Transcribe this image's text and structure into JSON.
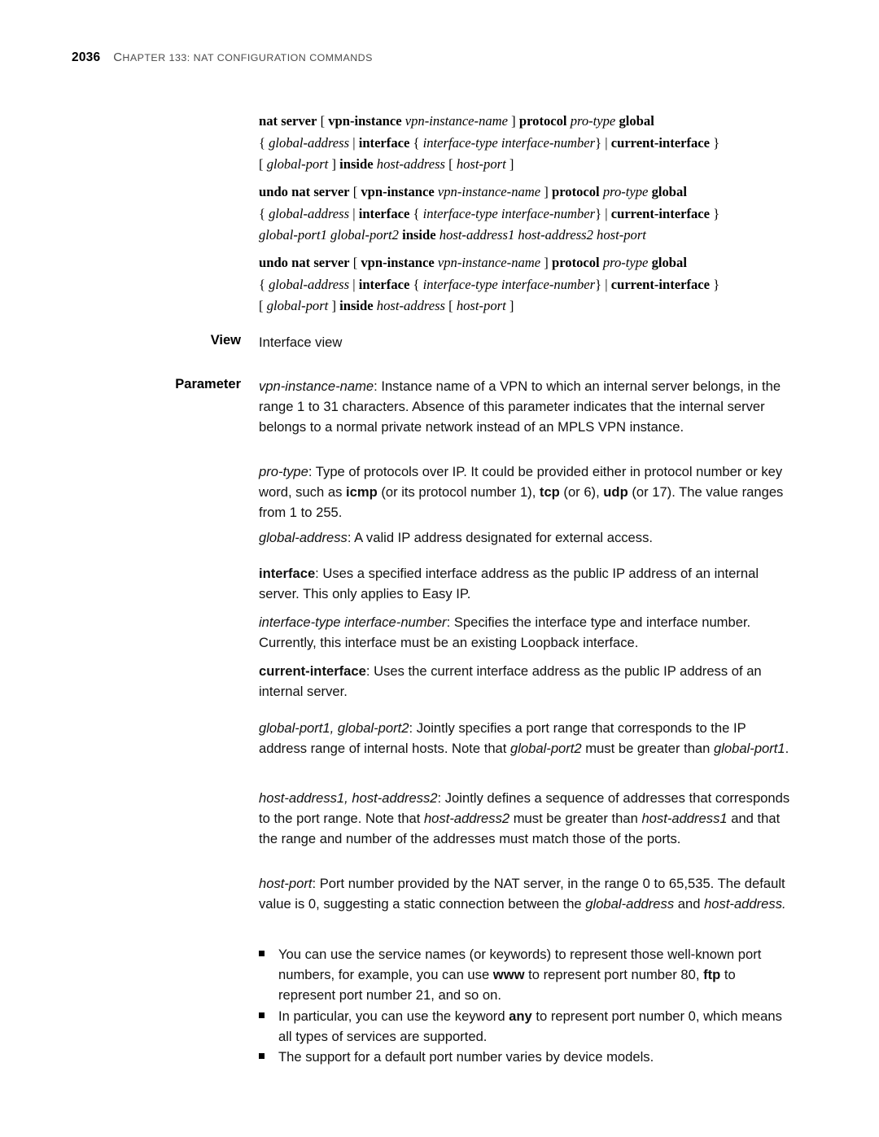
{
  "page": {
    "folio": "2036",
    "chapter_title_parts": {
      "c": "C",
      "hapter": "HAPTER",
      "num": " 133: NAT C",
      "onfiguration": "ONFIGURATION",
      "sep": " C",
      "ommands": "OMMANDS"
    },
    "chapter_title_plain": "CHAPTER 133: NAT CONFIGURATION COMMANDS"
  },
  "syntax_blocks": [
    {
      "id": "nat-server",
      "lines": [
        [
          {
            "t": "nat server",
            "s": "b"
          },
          {
            "t": " [ ",
            "s": "n"
          },
          {
            "t": "vpn-instance",
            "s": "b"
          },
          {
            "t": " ",
            "s": "n"
          },
          {
            "t": "vpn-instance-name",
            "s": "i"
          },
          {
            "t": " ] ",
            "s": "n"
          },
          {
            "t": "protocol",
            "s": "b"
          },
          {
            "t": " ",
            "s": "n"
          },
          {
            "t": "pro-type",
            "s": "i"
          },
          {
            "t": " ",
            "s": "n"
          },
          {
            "t": "global",
            "s": "b"
          }
        ],
        [
          {
            "t": "{ ",
            "s": "n"
          },
          {
            "t": "global-address",
            "s": "i"
          },
          {
            "t": " | ",
            "s": "n"
          },
          {
            "t": "interface",
            "s": "b"
          },
          {
            "t": " { ",
            "s": "n"
          },
          {
            "t": "interface-type interface-number",
            "s": "i"
          },
          {
            "t": "} | ",
            "s": "n"
          },
          {
            "t": "current-interface",
            "s": "b"
          },
          {
            "t": " }",
            "s": "n"
          }
        ],
        [
          {
            "t": "[ ",
            "s": "n"
          },
          {
            "t": "global-port",
            "s": "i"
          },
          {
            "t": " ] ",
            "s": "n"
          },
          {
            "t": "inside",
            "s": "b"
          },
          {
            "t": " ",
            "s": "n"
          },
          {
            "t": "host-address",
            "s": "i"
          },
          {
            "t": " [ ",
            "s": "n"
          },
          {
            "t": "host-port",
            "s": "i"
          },
          {
            "t": " ]",
            "s": "n"
          }
        ]
      ]
    },
    {
      "id": "undo-nat-server-range",
      "lines": [
        [
          {
            "t": "undo nat server",
            "s": "b"
          },
          {
            "t": " [ ",
            "s": "n"
          },
          {
            "t": "vpn-instance",
            "s": "b"
          },
          {
            "t": " ",
            "s": "n"
          },
          {
            "t": "vpn-instance-name",
            "s": "i"
          },
          {
            "t": " ] ",
            "s": "n"
          },
          {
            "t": "protocol",
            "s": "b"
          },
          {
            "t": " ",
            "s": "n"
          },
          {
            "t": "pro-type",
            "s": "i"
          },
          {
            "t": " ",
            "s": "n"
          },
          {
            "t": "global",
            "s": "b"
          }
        ],
        [
          {
            "t": "{ ",
            "s": "n"
          },
          {
            "t": "global-address",
            "s": "i"
          },
          {
            "t": " | ",
            "s": "n"
          },
          {
            "t": "interface",
            "s": "b"
          },
          {
            "t": " { ",
            "s": "n"
          },
          {
            "t": "interface-type interface-number",
            "s": "i"
          },
          {
            "t": "} | ",
            "s": "n"
          },
          {
            "t": "current-interface",
            "s": "b"
          },
          {
            "t": " }",
            "s": "n"
          }
        ],
        [
          {
            "t": "global-port1 global-port2",
            "s": "i"
          },
          {
            "t": " ",
            "s": "n"
          },
          {
            "t": "inside",
            "s": "b"
          },
          {
            "t": " ",
            "s": "n"
          },
          {
            "t": "host-address1 host-address2 host-port",
            "s": "i"
          }
        ]
      ]
    },
    {
      "id": "undo-nat-server-single",
      "lines": [
        [
          {
            "t": "undo nat server",
            "s": "b"
          },
          {
            "t": " [ ",
            "s": "n"
          },
          {
            "t": "vpn-instance",
            "s": "b"
          },
          {
            "t": " ",
            "s": "n"
          },
          {
            "t": "vpn-instance-name",
            "s": "i"
          },
          {
            "t": " ] ",
            "s": "n"
          },
          {
            "t": "protocol",
            "s": "b"
          },
          {
            "t": " ",
            "s": "n"
          },
          {
            "t": "pro-type",
            "s": "i"
          },
          {
            "t": " ",
            "s": "n"
          },
          {
            "t": "global",
            "s": "b"
          }
        ],
        [
          {
            "t": "{ ",
            "s": "n"
          },
          {
            "t": "global-address",
            "s": "i"
          },
          {
            "t": " | ",
            "s": "n"
          },
          {
            "t": "interface",
            "s": "b"
          },
          {
            "t": " { ",
            "s": "n"
          },
          {
            "t": "interface-type interface-number",
            "s": "i"
          },
          {
            "t": "} | ",
            "s": "n"
          },
          {
            "t": "current-interface",
            "s": "b"
          },
          {
            "t": " }",
            "s": "n"
          }
        ],
        [
          {
            "t": "[ ",
            "s": "n"
          },
          {
            "t": "global-port",
            "s": "i"
          },
          {
            "t": " ] ",
            "s": "n"
          },
          {
            "t": "inside",
            "s": "b"
          },
          {
            "t": " ",
            "s": "n"
          },
          {
            "t": "host-address",
            "s": "i"
          },
          {
            "t": " [ ",
            "s": "n"
          },
          {
            "t": "host-port",
            "s": "i"
          },
          {
            "t": " ]",
            "s": "n"
          }
        ]
      ]
    }
  ],
  "view": {
    "label": "View",
    "value": "Interface view"
  },
  "parameter": {
    "label": "Parameter",
    "paragraphs": [
      [
        {
          "t": "vpn-instance-name",
          "s": "i"
        },
        {
          "t": ": Instance name of a VPN to which an internal server belongs, in the range 1 to 31 characters. Absence of this parameter indicates that the internal server belongs to a normal private network instead of an MPLS VPN instance.",
          "s": "n"
        }
      ],
      [
        {
          "t": "pro-type",
          "s": "i"
        },
        {
          "t": ": Type of protocols over IP. It could be provided either in protocol number or key word, such as ",
          "s": "n"
        },
        {
          "t": "icmp",
          "s": "b"
        },
        {
          "t": " (or its protocol number 1), ",
          "s": "n"
        },
        {
          "t": "tcp",
          "s": "b"
        },
        {
          "t": " (or 6), ",
          "s": "n"
        },
        {
          "t": "udp",
          "s": "b"
        },
        {
          "t": " (or 17). The value ranges from 1 to 255.",
          "s": "n"
        }
      ],
      [
        {
          "t": "global-address",
          "s": "i"
        },
        {
          "t": ": A valid IP address designated for external access.",
          "s": "n"
        }
      ],
      [
        {
          "t": "interface",
          "s": "b"
        },
        {
          "t": ": Uses a specified interface address as the public IP address of an internal server. This only applies to Easy IP.",
          "s": "n"
        }
      ],
      [
        {
          "t": "interface-type interface-number",
          "s": "i"
        },
        {
          "t": ": Specifies the interface type and interface number. Currently, this interface must be an existing Loopback interface.",
          "s": "n"
        }
      ],
      [
        {
          "t": "current-interface",
          "s": "b"
        },
        {
          "t": ": Uses the current interface address as the public IP address of an internal server.",
          "s": "n"
        }
      ],
      [
        {
          "t": "global-port1, global-port2",
          "s": "i"
        },
        {
          "t": ": Jointly specifies a port range that corresponds to the IP address range of internal hosts. Note that ",
          "s": "n"
        },
        {
          "t": "global-port2",
          "s": "i"
        },
        {
          "t": " must be greater than ",
          "s": "n"
        },
        {
          "t": "global-port1",
          "s": "i"
        },
        {
          "t": ".",
          "s": "n"
        }
      ],
      [
        {
          "t": "host-address1, host-address2",
          "s": "i"
        },
        {
          "t": ": Jointly defines a sequence of addresses that corresponds to the port range. Note that ",
          "s": "n"
        },
        {
          "t": "host-address2",
          "s": "i"
        },
        {
          "t": " must be greater than ",
          "s": "n"
        },
        {
          "t": "host-address1",
          "s": "i"
        },
        {
          "t": " and that the range and number of the addresses must match those of the ports.",
          "s": "n"
        }
      ],
      [
        {
          "t": "host-port",
          "s": "i"
        },
        {
          "t": ": Port number provided by the NAT server, in the range 0 to 65,535. The default value is 0, suggesting a static connection between the ",
          "s": "n"
        },
        {
          "t": "global-address",
          "s": "i"
        },
        {
          "t": " and ",
          "s": "n"
        },
        {
          "t": "host-address.",
          "s": "i"
        }
      ]
    ],
    "bullets": [
      [
        {
          "t": "You can use the service names (or keywords) to represent those well-known port numbers, for example, you can use ",
          "s": "n"
        },
        {
          "t": "www",
          "s": "b"
        },
        {
          "t": " to represent port number 80, ",
          "s": "n"
        },
        {
          "t": "ftp",
          "s": "b"
        },
        {
          "t": " to represent port number 21, and so on.",
          "s": "n"
        }
      ],
      [
        {
          "t": "In particular, you can use the keyword ",
          "s": "n"
        },
        {
          "t": "any",
          "s": "b"
        },
        {
          "t": " to represent port number 0, which means all types of services are supported.",
          "s": "n"
        }
      ],
      [
        {
          "t": "The support for a default port number varies by device models.",
          "s": "n"
        }
      ]
    ]
  },
  "colors": {
    "text": "#111111",
    "header_gray": "#4b4b4b",
    "bullet": "#000000",
    "page_background": "#ffffff"
  }
}
